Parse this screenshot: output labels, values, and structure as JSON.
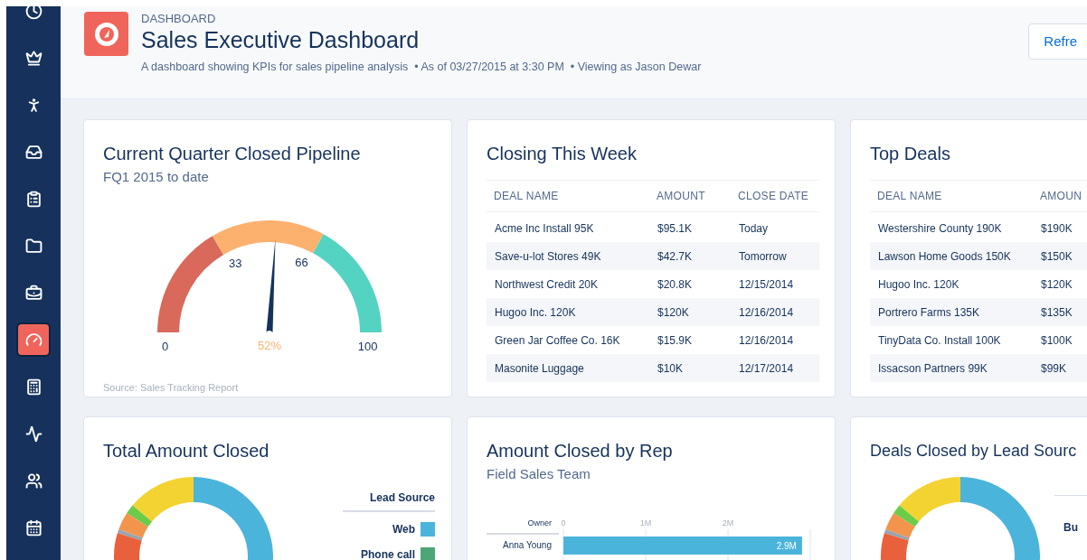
{
  "sidebar": {
    "items": [
      {
        "selected": false
      },
      {
        "selected": false
      },
      {
        "selected": false
      },
      {
        "selected": false
      },
      {
        "selected": false
      },
      {
        "selected": false
      },
      {
        "selected": false
      },
      {
        "selected": true
      },
      {
        "selected": false
      },
      {
        "selected": false
      },
      {
        "selected": false
      },
      {
        "selected": false
      }
    ]
  },
  "header": {
    "eyebrow": "DASHBOARD",
    "title": "Sales Executive Dashboard",
    "subtitle": "A dashboard showing KPIs for sales pipeline analysis  • As of 03/27/2015 at 3:30 PM  • Viewing as Jason Dewar",
    "button": "Refre"
  },
  "cards": [
    {
      "kind": "gauge",
      "title": "Current Quarter Closed Pipeline",
      "subtitle": "FQ1 2015 to date",
      "ticks": [
        "0",
        "33",
        "66",
        "100"
      ],
      "reading": "52%",
      "footer": "Source: Sales Tracking Report"
    },
    {
      "kind": "table",
      "title": "Closing This Week",
      "columns": [
        "DEAL NAME",
        "AMOUNT",
        "CLOSE DATE"
      ],
      "rows": [
        [
          "Acme Inc Install 95K",
          "$95.1K",
          "Today"
        ],
        [
          "Save-u-lot Stores 49K",
          "$42.7K",
          "Tomorrow"
        ],
        [
          "Northwest Credit 20K",
          "$20.8K",
          "12/15/2014"
        ],
        [
          "Hugoo Inc. 120K",
          "$120K",
          "12/16/2014"
        ],
        [
          "Green Jar Coffee Co. 16K",
          "$15.9K",
          "12/16/2014"
        ],
        [
          "Masonite Luggage",
          "$10K",
          "12/17/2014"
        ]
      ]
    },
    {
      "kind": "table",
      "title": "Top Deals",
      "columns": [
        "DEAL NAME",
        "AMOUN"
      ],
      "rows": [
        [
          "Westershire County 190K",
          "$190K"
        ],
        [
          "Lawson Home Goods 150K",
          "$150K"
        ],
        [
          "Hugoo Inc. 120K",
          "$120K"
        ],
        [
          "Portrero Farms 135K",
          "$135K"
        ],
        [
          "TinyData Co. Install 100K",
          "$100K"
        ],
        [
          "Issacson Partners 99K",
          "$99K"
        ]
      ]
    },
    {
      "kind": "donut",
      "title": "Total Amount Closed",
      "legend": {
        "title": "Lead Source",
        "items": [
          {
            "label": "Web",
            "color": "#4bb4db"
          },
          {
            "label": "Phone call",
            "color": "#4ea577"
          }
        ]
      }
    },
    {
      "kind": "bars",
      "title": "Amount Closed by Rep",
      "subtitle": "Field Sales Team",
      "chart_data": {
        "type": "bar",
        "orientation": "horizontal",
        "ylabel": "Owner",
        "categories": [
          "Anna Young"
        ],
        "values": [
          2.9
        ],
        "xlim": [
          0,
          3
        ],
        "xticks": [
          {
            "value": 0,
            "label": "0"
          },
          {
            "value": 1,
            "label": "1M"
          },
          {
            "value": 2,
            "label": "2M"
          }
        ],
        "data_labels": true,
        "value_labels": [
          "2.9M"
        ]
      }
    },
    {
      "kind": "donut",
      "title": "Deals Closed by Lead Sourc",
      "legend": {
        "items": [
          {
            "label": "Bu"
          }
        ]
      }
    }
  ]
}
